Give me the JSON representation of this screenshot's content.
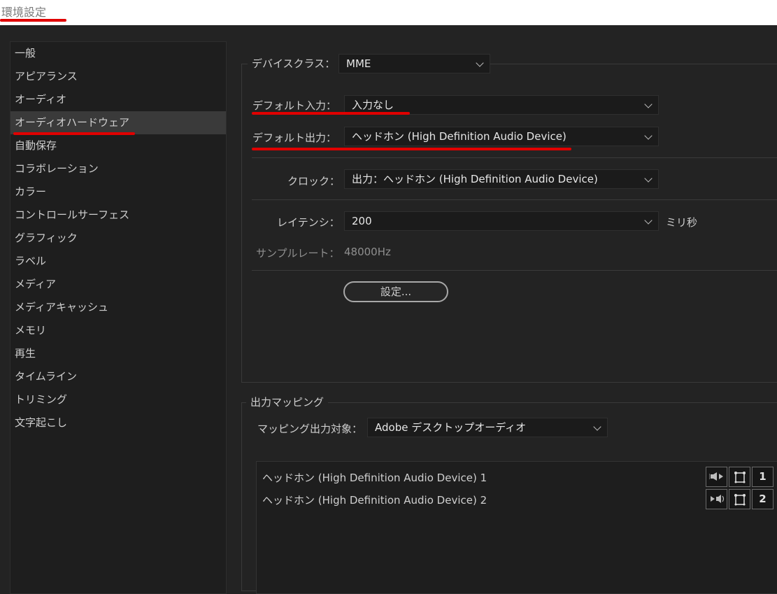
{
  "window": {
    "title": "環境設定"
  },
  "sidebar": {
    "items": [
      {
        "label": "一般"
      },
      {
        "label": "アピアランス"
      },
      {
        "label": "オーディオ"
      },
      {
        "label": "オーディオハードウェア",
        "active": true
      },
      {
        "label": "自動保存"
      },
      {
        "label": "コラボレーション"
      },
      {
        "label": "カラー"
      },
      {
        "label": "コントロールサーフェス"
      },
      {
        "label": "グラフィック"
      },
      {
        "label": "ラベル"
      },
      {
        "label": "メディア"
      },
      {
        "label": "メディアキャッシュ"
      },
      {
        "label": "メモリ"
      },
      {
        "label": "再生"
      },
      {
        "label": "タイムライン"
      },
      {
        "label": "トリミング"
      },
      {
        "label": "文字起こし"
      }
    ]
  },
  "device": {
    "class_label": "デバイスクラス：",
    "class_value": "MME",
    "default_input_label": "デフォルト入力：",
    "default_input_value": "入力なし",
    "default_output_label": "デフォルト出力：",
    "default_output_value": "ヘッドホン (High Definition Audio Device)",
    "clock_label": "クロック：",
    "clock_value": "出力：ヘッドホン (High Definition Audio Device)",
    "latency_label": "レイテンシ：",
    "latency_value": "200",
    "latency_unit": "ミリ秒",
    "samplerate_label": "サンプルレート：",
    "samplerate_value": "48000Hz",
    "settings_button": "設定..."
  },
  "output_mapping": {
    "title": "出力マッピング",
    "target_label": "マッピング出力対象：",
    "target_value": "Adobe デスクトップオーディオ",
    "rows": [
      {
        "label": "ヘッドホン (High Definition Audio Device) 1",
        "channel": "1",
        "speaker_icon": "speaker-left-icon"
      },
      {
        "label": "ヘッドホン (High Definition Audio Device) 2",
        "channel": "2",
        "speaker_icon": "speaker-right-icon"
      }
    ]
  },
  "colors": {
    "annotation_red": "#e00000",
    "background": "#232323",
    "panel": "#1e1e1e"
  }
}
